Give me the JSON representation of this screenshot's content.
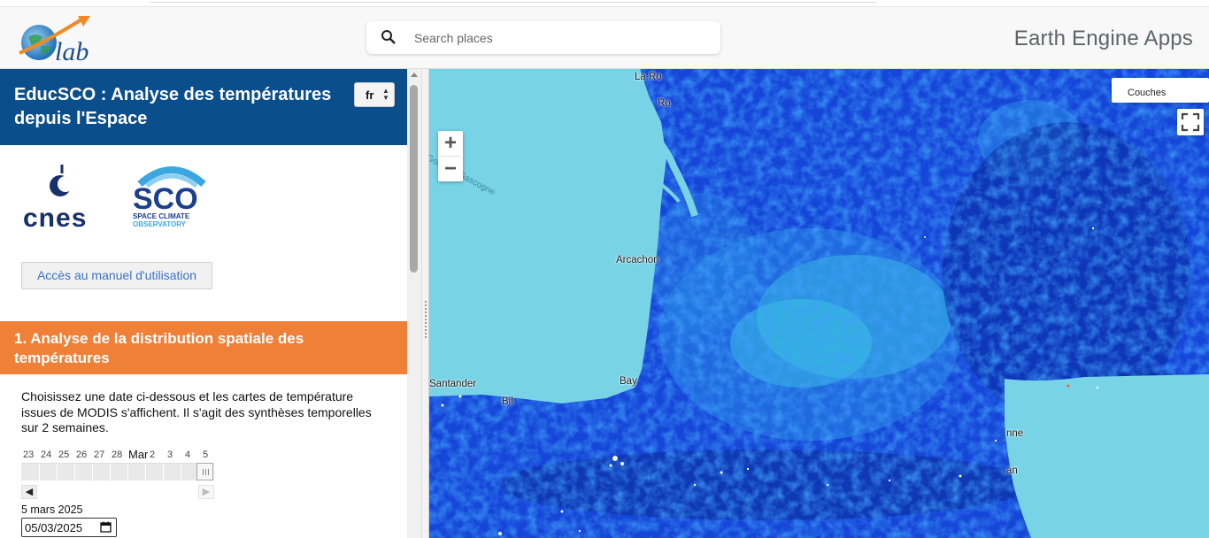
{
  "header": {
    "logo_name": "Olab",
    "search_placeholder": "Search places",
    "apps_title": "Earth Engine Apps"
  },
  "panel": {
    "title": "EducSCO : Analyse des températures depuis l'Espace",
    "language": "fr",
    "logos": [
      "cnes",
      "SCO Space Climate Observatory"
    ],
    "manual_button": "Accès au manuel d'utilisation",
    "section1_title": "1. Analyse de la distribution spatiale des températures",
    "section1_description": "Choisissez une date ci-dessous et les cartes de température issues de MODIS s'affichent. Il s'agit des synthèses temporelles sur 2 semaines.",
    "timeline_ticks": [
      "23",
      "24",
      "25",
      "26",
      "27",
      "28",
      "Mar",
      "2",
      "3",
      "4",
      "5"
    ],
    "selected_date_label": "5 mars 2025",
    "date_input_value": "05/03/2025"
  },
  "map": {
    "layers_button": "Couches",
    "zoom_in": "+",
    "zoom_out": "−",
    "places": [
      "La Ro",
      "Ro",
      "Arcachon",
      "Bay",
      "Santander",
      "Bil",
      "nne",
      "an"
    ],
    "sea_label": "Golfe de Gascogne",
    "colors": {
      "ocean": "#79d3e6",
      "land_cold": "#0a2aa8",
      "land_mid": "#1a55e0",
      "land_warm": "#33c8e0"
    }
  },
  "icons": [
    "search-icon",
    "chevron-updown-icon",
    "calendar-icon",
    "fullscreen-icon",
    "arrow-left-icon",
    "arrow-right-icon"
  ]
}
